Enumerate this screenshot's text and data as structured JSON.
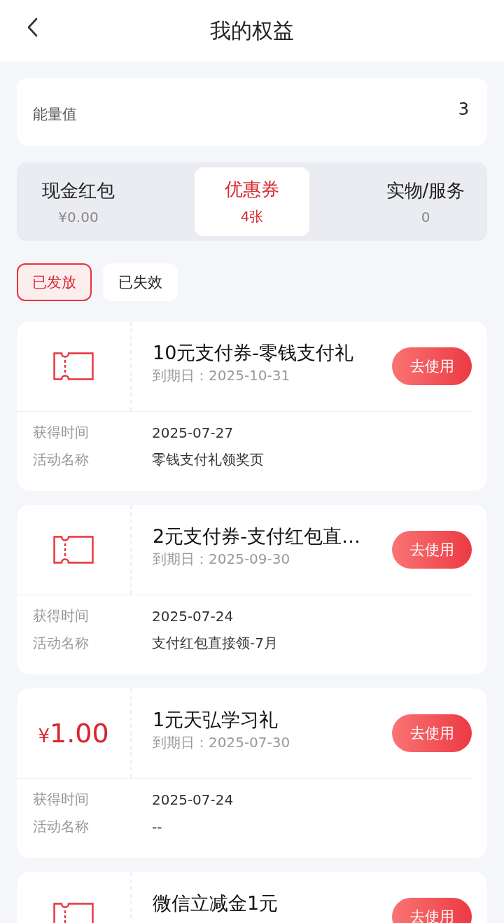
{
  "header": {
    "title": "我的权益"
  },
  "energy": {
    "label": "能量值",
    "value": "3"
  },
  "tabs": [
    {
      "label": "现金红包",
      "sub": "¥0.00",
      "selected": false
    },
    {
      "label": "优惠券",
      "sub": "4张",
      "selected": true
    },
    {
      "label": "实物/服务",
      "sub": "0",
      "selected": false
    }
  ],
  "filters": [
    {
      "label": "已发放",
      "selected": true
    },
    {
      "label": "已失效",
      "selected": false
    }
  ],
  "coupons": [
    {
      "kind": "ticket",
      "title": "10元支付券-零钱支付礼",
      "expiry": "到期日：2025-10-31",
      "button": "去使用",
      "rows": [
        {
          "label": "获得时间",
          "value": "2025-07-27"
        },
        {
          "label": "活动名称",
          "value": "零钱支付礼领奖页"
        }
      ]
    },
    {
      "kind": "ticket",
      "title": "2元支付券-支付红包直…",
      "expiry": "到期日：2025-09-30",
      "button": "去使用",
      "rows": [
        {
          "label": "获得时间",
          "value": "2025-07-24"
        },
        {
          "label": "活动名称",
          "value": "支付红包直接领-7月"
        }
      ]
    },
    {
      "kind": "amount",
      "currency": "¥",
      "amount": "1.00",
      "title": "1元天弘学习礼",
      "expiry": "到期日：2025-07-30",
      "button": "去使用",
      "rows": [
        {
          "label": "获得时间",
          "value": "2025-07-24"
        },
        {
          "label": "活动名称",
          "value": "--"
        }
      ]
    },
    {
      "kind": "ticket",
      "title": "微信立减金1元",
      "button": "去使用"
    }
  ]
}
